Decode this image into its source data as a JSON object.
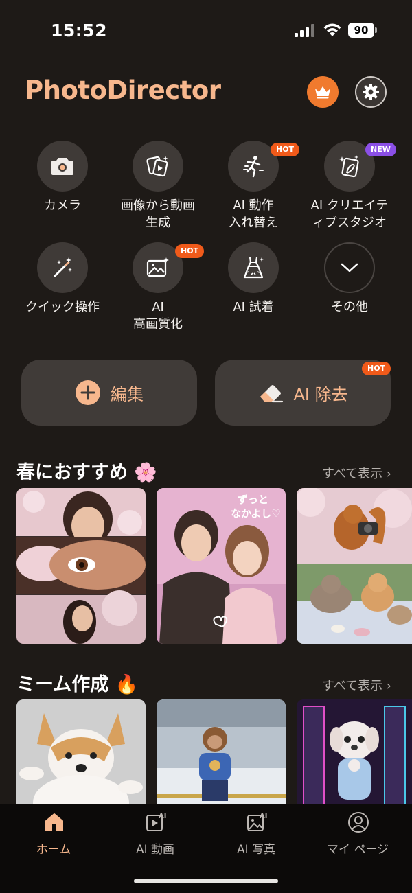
{
  "status_bar": {
    "time": "15:52",
    "battery": "90"
  },
  "header": {
    "title": "PhotoDirector"
  },
  "tools": [
    {
      "label": "カメラ",
      "icon": "camera-icon"
    },
    {
      "label": "画像から動画\n生成",
      "icon": "image-to-video-icon"
    },
    {
      "label": "AI 動作\n入れ替え",
      "icon": "motion-swap-icon",
      "badge": "HOT"
    },
    {
      "label": "AI クリエイテ\nィブスタジオ",
      "icon": "creative-studio-icon",
      "badge": "NEW"
    },
    {
      "label": "クイック操作",
      "icon": "magic-wand-icon"
    },
    {
      "label": "AI\n高画質化",
      "icon": "enhance-image-icon",
      "badge": "HOT"
    },
    {
      "label": "AI 試着",
      "icon": "dress-icon"
    },
    {
      "label": "その他",
      "icon": "chevron-down-icon"
    }
  ],
  "actions": {
    "edit_label": "編集",
    "remove_label": "AI 除去",
    "remove_badge": "HOT"
  },
  "sections": [
    {
      "title": "春におすすめ 🌸",
      "see_all": "すべて表示 ›"
    },
    {
      "title": "ミーム作成 🔥",
      "see_all": "すべて表示 ›"
    }
  ],
  "cards": {
    "spring_2_text": "ずっと\nなかよし♡"
  },
  "bottom_nav": [
    {
      "label": "ホーム",
      "icon": "home-icon",
      "active": true
    },
    {
      "label": "AI 動画",
      "icon": "ai-video-icon"
    },
    {
      "label": "AI 写真",
      "icon": "ai-photo-icon"
    },
    {
      "label": "マイ ページ",
      "icon": "profile-icon"
    }
  ],
  "colors": {
    "accent": "#f7b78d",
    "premium": "#f07a2e",
    "hot_badge": "#f05a1a",
    "new_badge": "#8b4fe6",
    "background": "#1e1a17"
  }
}
